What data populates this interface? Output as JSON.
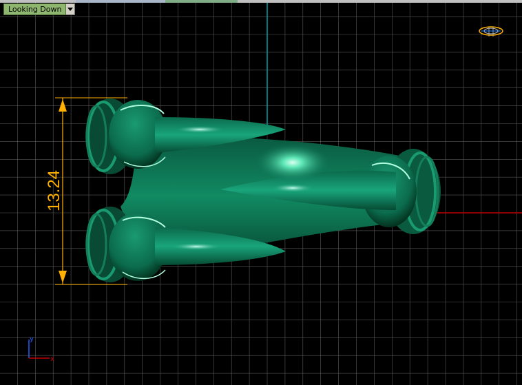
{
  "viewport": {
    "title": "Looking Down",
    "projection": "top",
    "background": "#000000",
    "grid_color": "#5a5a5a",
    "x_axis_color": "#c00000",
    "y_axis_color": "#00a0b0"
  },
  "model": {
    "color": "#0f7a58",
    "highlight": "#9fffe0"
  },
  "dimension": {
    "value": "13.24",
    "color": "#ffb000"
  },
  "axis_indicator": {
    "x_label": "x",
    "y_label": "y"
  },
  "icons": {
    "dropdown": "chevron-down-icon",
    "gumball": "gumball-icon"
  }
}
